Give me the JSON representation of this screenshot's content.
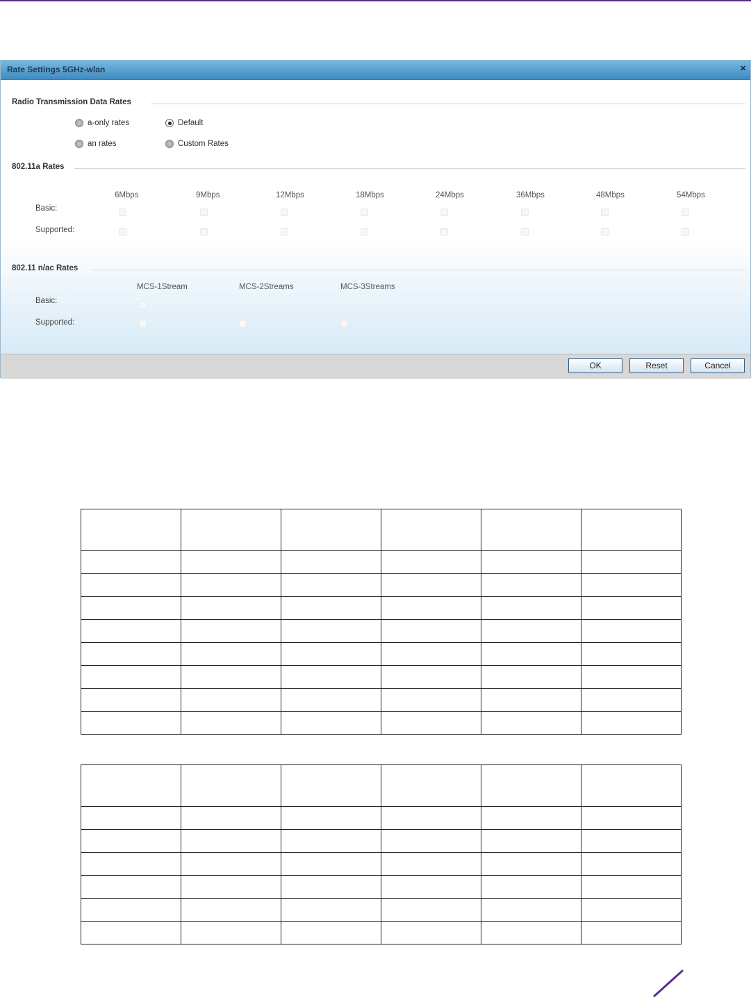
{
  "dialog": {
    "title": "Rate Settings 5GHz-wlan",
    "close_glyph": "×",
    "sections": {
      "radio_tx": "Radio Transmission Data Rates",
      "rates_80211a": "802.11a Rates",
      "rates_80211nac": "802.11 n/ac Rates"
    },
    "radio_options": [
      {
        "label": "a-only rates",
        "selected": false
      },
      {
        "label": "Default",
        "selected": true
      },
      {
        "label": "an rates",
        "selected": false
      },
      {
        "label": "Custom Rates",
        "selected": false
      }
    ],
    "a_rates": {
      "headers": [
        "6Mbps",
        "9Mbps",
        "12Mbps",
        "18Mbps",
        "24Mbps",
        "36Mbps",
        "48Mbps",
        "54Mbps"
      ],
      "row_labels": [
        "Basic:",
        "Supported:"
      ]
    },
    "nac_rates": {
      "headers": [
        "MCS-1Stream",
        "MCS-2Streams",
        "MCS-3Streams"
      ],
      "row_labels": [
        "Basic:",
        "Supported:"
      ]
    },
    "buttons": {
      "ok": "OK",
      "reset": "Reset",
      "cancel": "Cancel"
    }
  },
  "colors": {
    "accent": "#5b2c8f",
    "titlebar": "#4a93c8"
  }
}
